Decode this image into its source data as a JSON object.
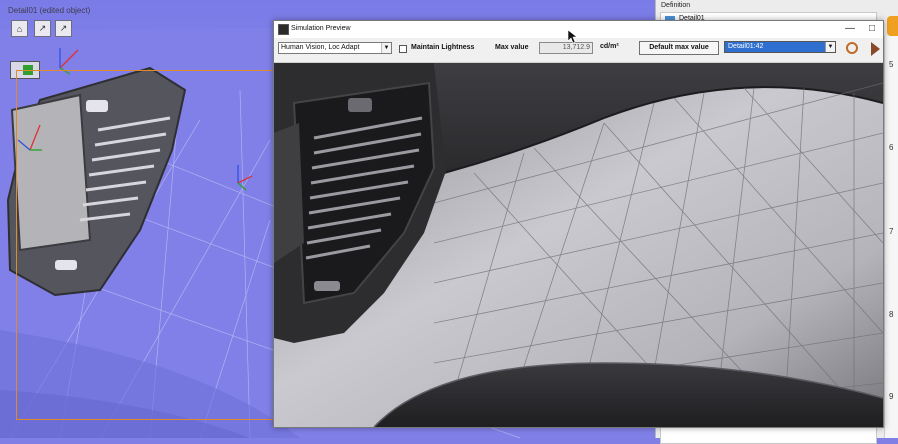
{
  "viewport": {
    "title": "Detail01 (edited object)",
    "buttons": [
      "⌂",
      "↗",
      "↗"
    ]
  },
  "right_panel": {
    "section_label": "Definition",
    "tree_item": "Detail01",
    "strip_numbers": [
      "5",
      "6",
      "7",
      "8",
      "9"
    ]
  },
  "sim_window": {
    "title": "Simulation Preview",
    "window_buttons": [
      "—",
      "□"
    ],
    "mode_select": "Human Vision, Loc Adapt",
    "maintain_lightness_label": "Maintain Lightness",
    "maintain_lightness_checked": false,
    "max_value_label": "Max value",
    "max_value": "13,712.9",
    "unit_label": "cd/m²",
    "default_max_button": "Default max value",
    "detail_select": "Detail01:42"
  },
  "colors": {
    "viewport_bg": "#7f7fe6",
    "selection_frame": "#e08a30",
    "accent_blue": "#2f6fd0",
    "orange_tab": "#f0a020"
  },
  "icons": [
    "home-icon",
    "pointer-icon",
    "axis-gizmo-icon",
    "refresh-icon",
    "play-icon",
    "checkbox-icon"
  ]
}
